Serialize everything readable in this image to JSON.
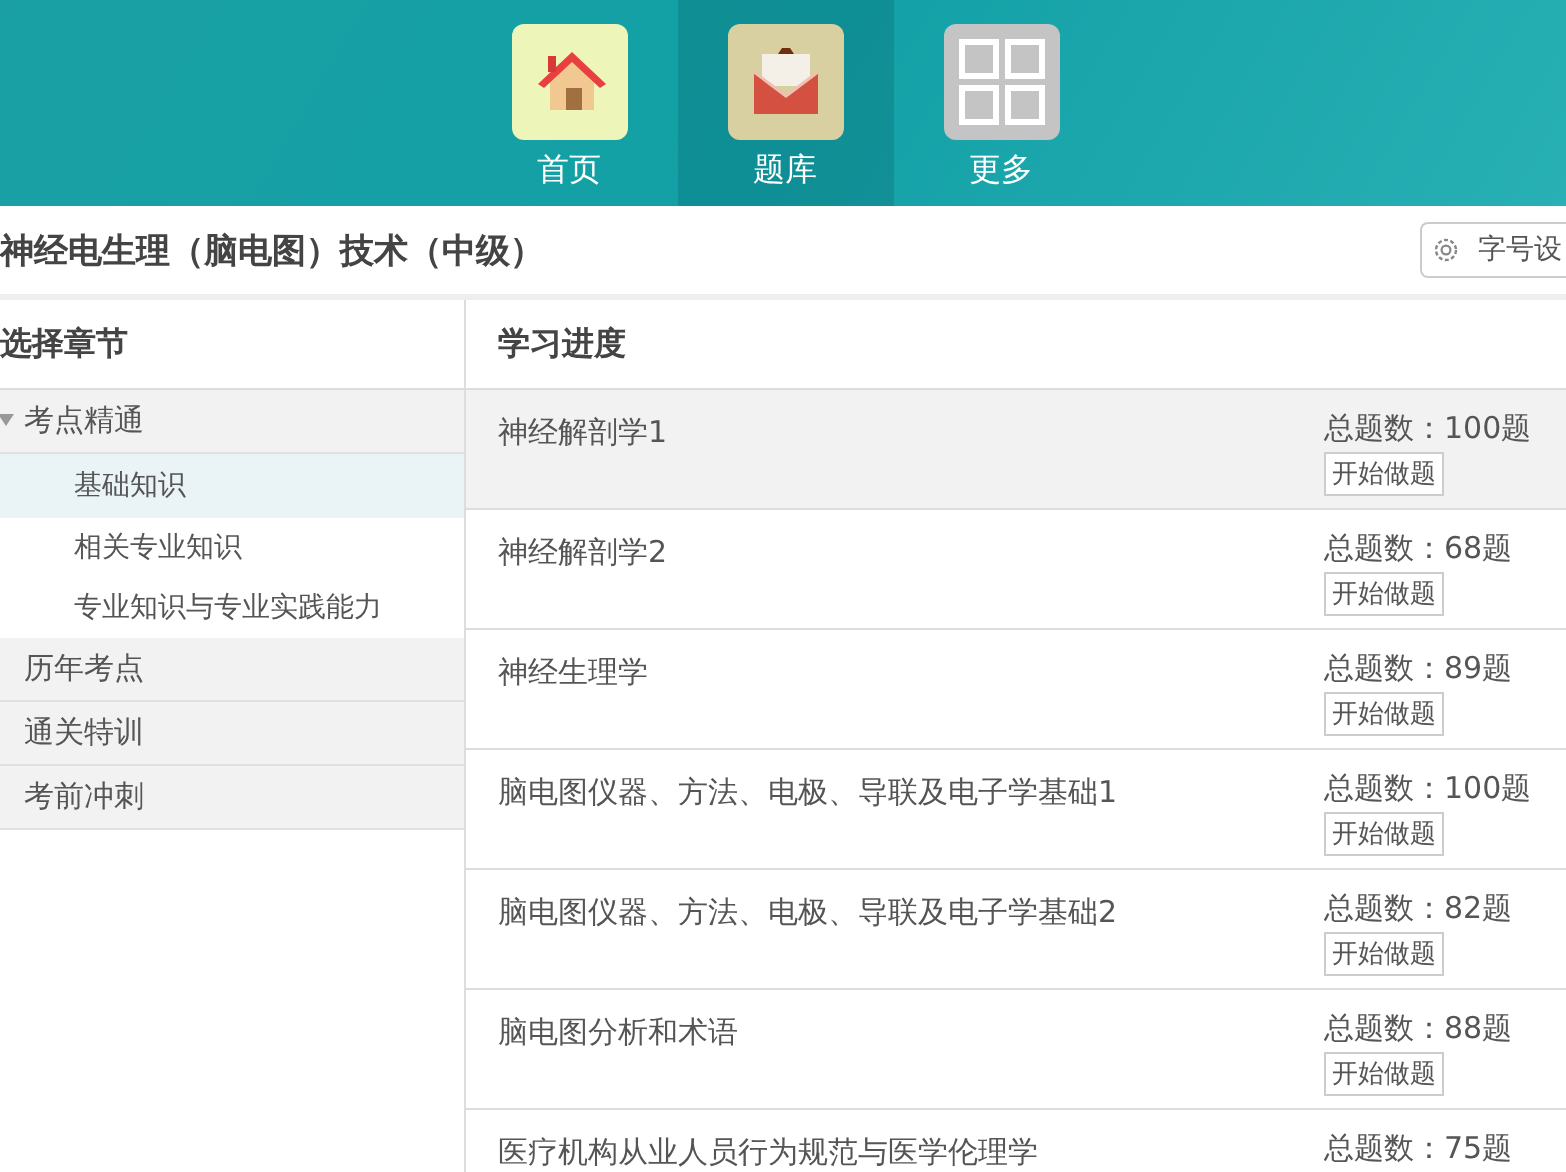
{
  "nav_tabs": [
    {
      "label": "首页",
      "selected": false
    },
    {
      "label": "题库",
      "selected": true
    },
    {
      "label": "更多",
      "selected": false
    }
  ],
  "title": "神经电生理（脑电图）技术（中级）",
  "font_button": "字号设",
  "sidebar": {
    "heading": "选择章节",
    "items": [
      {
        "label": "考点精通",
        "expanded": true,
        "children": [
          {
            "label": "基础知识",
            "selected": true
          },
          {
            "label": "相关专业知识",
            "selected": false
          },
          {
            "label": "专业知识与专业实践能力",
            "selected": false
          }
        ]
      },
      {
        "label": "历年考点",
        "expanded": false
      },
      {
        "label": "通关特训",
        "expanded": false
      },
      {
        "label": "考前冲刺",
        "expanded": false
      }
    ]
  },
  "progress": {
    "heading": "学习进度",
    "rows": [
      {
        "name": "神经解剖学1",
        "count": "总题数：100题",
        "action": "开始做题",
        "selected": true
      },
      {
        "name": "神经解剖学2",
        "count": "总题数：68题",
        "action": "开始做题",
        "selected": false
      },
      {
        "name": "神经生理学",
        "count": "总题数：89题",
        "action": "开始做题",
        "selected": false
      },
      {
        "name": "脑电图仪器、方法、电极、导联及电子学基础1",
        "count": "总题数：100题",
        "action": "开始做题",
        "selected": false
      },
      {
        "name": "脑电图仪器、方法、电极、导联及电子学基础2",
        "count": "总题数：82题",
        "action": "开始做题",
        "selected": false
      },
      {
        "name": "脑电图分析和术语",
        "count": "总题数：88题",
        "action": "开始做题",
        "selected": false
      },
      {
        "name": "医疗机构从业人员行为规范与医学伦理学",
        "count": "总题数：75题",
        "selected": false
      }
    ]
  }
}
